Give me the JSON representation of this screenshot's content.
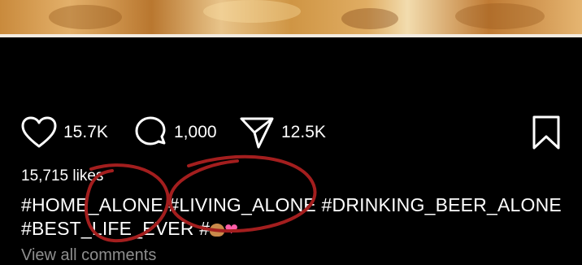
{
  "post": {
    "actions": {
      "likes_count": "15.7K",
      "comments_count": "1,000",
      "shares_count": "12.5K"
    },
    "likes_text": "15,715 likes",
    "caption_tags": [
      "#HOME_ALONE",
      "#LIVING_ALONE",
      "#DRINKING_BEER_ALONE",
      "#BEST_LIFE_EVER",
      "#"
    ],
    "caption_emojis": [
      "cookie-emoji",
      "hearts-emoji"
    ],
    "view_comments_label": "View all comments"
  },
  "icons": {
    "like": "heart-icon",
    "comment": "comment-bubble-icon",
    "share": "send-icon",
    "save": "bookmark-icon"
  },
  "colors": {
    "background": "#000000",
    "text": "#ffffff",
    "muted": "#8e8e8e",
    "annotation": "#a31e1e"
  }
}
